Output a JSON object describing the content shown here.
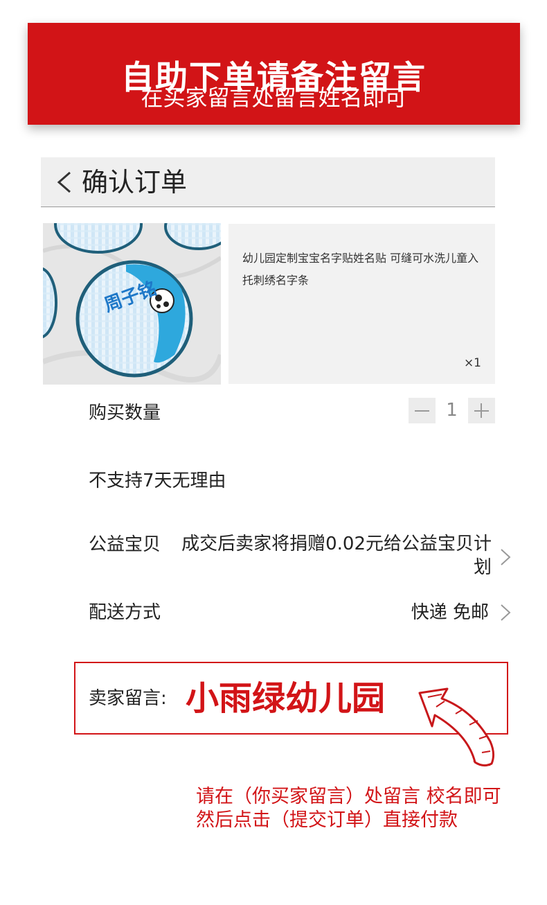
{
  "banner": {
    "title": "自助下单请备注留言",
    "subtitle": "在买家留言处留言姓名即可"
  },
  "header": {
    "title": "确认订单",
    "back_icon": "chevron-left-icon"
  },
  "product": {
    "image_label": "周子铭",
    "name": "幼儿园定制宝宝名字贴姓名贴 可缝可水洗儿童入托刺绣名字条",
    "quantity_label": "×1"
  },
  "purchase_quantity": {
    "label": "购买数量",
    "value": "1"
  },
  "return_policy": {
    "label": "不支持7天无理由"
  },
  "charity": {
    "label": "公益宝贝",
    "description": "成交后卖家将捐赠0.02元给公益宝贝计划"
  },
  "shipping": {
    "label": "配送方式",
    "value": "快递 免邮"
  },
  "seller_message": {
    "label": "卖家留言:",
    "value": "小雨绿幼儿园"
  },
  "instructions": {
    "line1": "请在（你买家留言）处留言 校名即可",
    "line2": "然后点击（提交订单）直接付款"
  },
  "colors": {
    "accent_red": "#d21417",
    "panel_gray": "#f2f2f2",
    "text_dark": "#222222"
  }
}
